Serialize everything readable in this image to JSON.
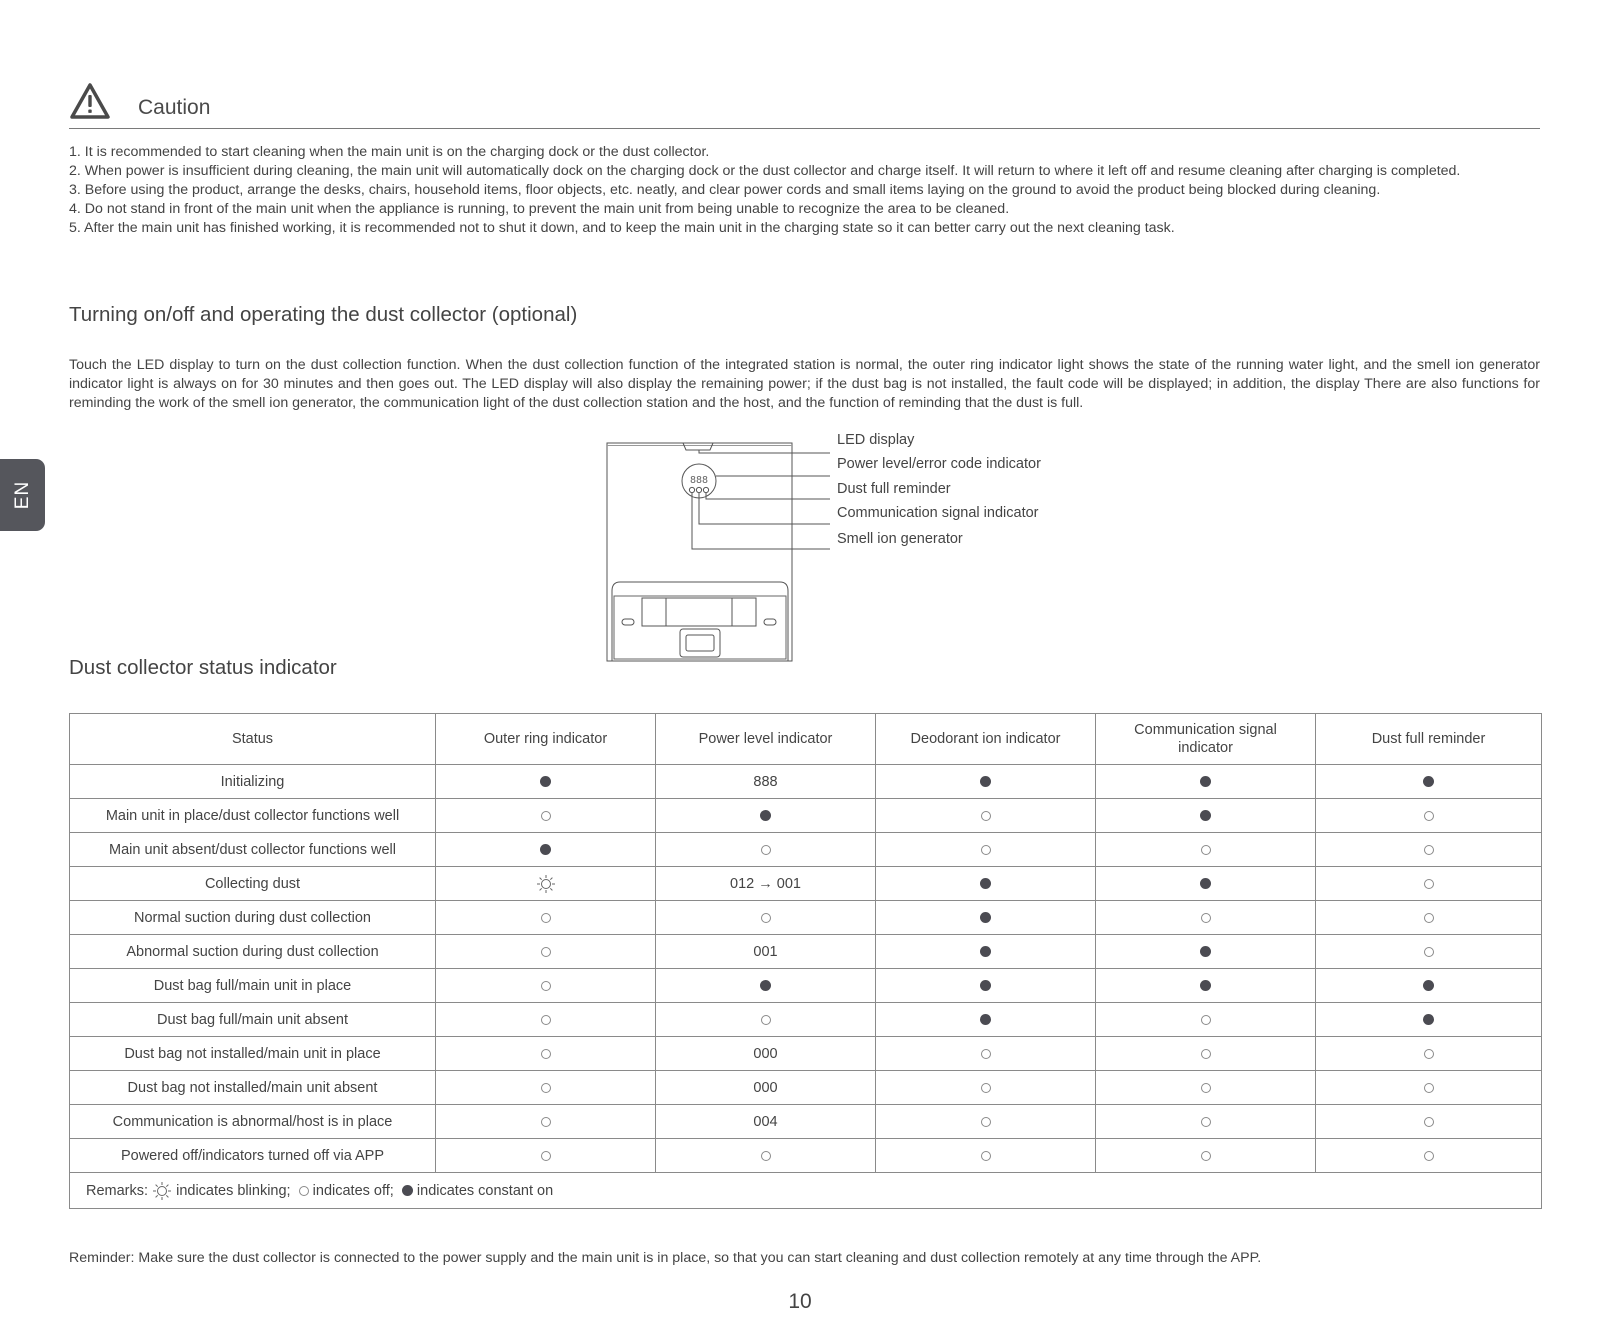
{
  "side_tab": {
    "label": "EN"
  },
  "caution": {
    "icon": "warning-triangle-icon",
    "title": "Caution",
    "items": [
      "1. It is recommended to start cleaning when the main unit is on the charging dock or the dust collector.",
      "2. When power is insufficient during cleaning, the main unit will automatically dock on the charging dock or the dust collector and charge itself. It will return to where it left off and resume cleaning after charging is completed.",
      "3. Before using the product, arrange the desks, chairs, household items, floor objects, etc. neatly, and clear power cords and small items laying on the ground to avoid the product being blocked during cleaning.",
      "4. Do not stand in front of the main unit when the appliance is running, to prevent the main unit from being unable to recognize the area to be cleaned.",
      "5. After the main unit has finished working, it is recommended not to shut it down, and to keep the main unit in the charging state so it can better carry out the next cleaning task."
    ]
  },
  "operating": {
    "heading": "Turning on/off and operating the dust collector (optional)",
    "intro": "Touch the LED display to turn on the dust collection function. When the dust collection function of the integrated station is normal, the outer ring indicator light shows the state of the running water light, and the smell ion generator indicator light is always on for 30 minutes and then goes out. The LED display will also display the remaining power; if the dust bag is not installed, the fault code will be displayed; in addition, the display There are also functions for reminding the work of the smell ion generator, the communication light of the dust collection station and the host, and the function of reminding that the dust is full.",
    "diagram": {
      "display_digits": "888",
      "callouts": [
        "LED display",
        "Power level/error code indicator",
        "Dust full reminder",
        "Communication signal indicator",
        "Smell ion generator"
      ]
    }
  },
  "status_table": {
    "heading": "Dust collector status indicator",
    "columns": [
      "Status",
      "Outer ring indicator",
      "Power level indicator",
      "Deodorant ion indicator",
      "Communication signal indicator",
      "Dust full reminder"
    ],
    "rows": [
      {
        "status": "Initializing",
        "cells": [
          "on",
          "888",
          "on",
          "on",
          "on"
        ]
      },
      {
        "status": "Main unit in place/dust collector functions well",
        "cells": [
          "off",
          "on",
          "off",
          "on",
          "off"
        ]
      },
      {
        "status": "Main unit absent/dust collector functions well",
        "cells": [
          "on",
          "off",
          "off",
          "off",
          "off"
        ]
      },
      {
        "status": "Collecting dust",
        "cells": [
          "blink",
          "012 → 001",
          "on",
          "on",
          "off"
        ]
      },
      {
        "status": "Normal suction during dust collection",
        "cells": [
          "off",
          "off",
          "on",
          "off",
          "off"
        ]
      },
      {
        "status": "Abnormal suction during dust collection",
        "cells": [
          "off",
          "001",
          "on",
          "on",
          "off"
        ]
      },
      {
        "status": "Dust bag full/main unit in place",
        "cells": [
          "off",
          "on",
          "on",
          "on",
          "on"
        ]
      },
      {
        "status": "Dust bag full/main unit absent",
        "cells": [
          "off",
          "off",
          "on",
          "off",
          "on"
        ]
      },
      {
        "status": "Dust bag not installed/main unit in place",
        "cells": [
          "off",
          "000",
          "off",
          "off",
          "off"
        ]
      },
      {
        "status": "Dust bag not installed/main unit absent",
        "cells": [
          "off",
          "000",
          "off",
          "off",
          "off"
        ]
      },
      {
        "status": "Communication is abnormal/host is in place",
        "cells": [
          "off",
          "004",
          "off",
          "off",
          "off"
        ]
      },
      {
        "status": "Powered off/indicators turned off via APP",
        "cells": [
          "off",
          "off",
          "off",
          "off",
          "off"
        ]
      }
    ],
    "remarks": {
      "prefix": "Remarks:",
      "blink_text": "indicates blinking;",
      "off_text": "indicates off;",
      "on_text": "indicates constant on"
    }
  },
  "reminder": "Reminder: Make sure the dust collector is connected to the power supply and the main unit is in place, so that you can start cleaning and dust collection remotely at any time through the APP.",
  "page_number": "10",
  "colors": {
    "text": "#444444",
    "dot_on": "#4b4b52",
    "side_tab": "#55565c",
    "rule": "#7a7a7a"
  }
}
